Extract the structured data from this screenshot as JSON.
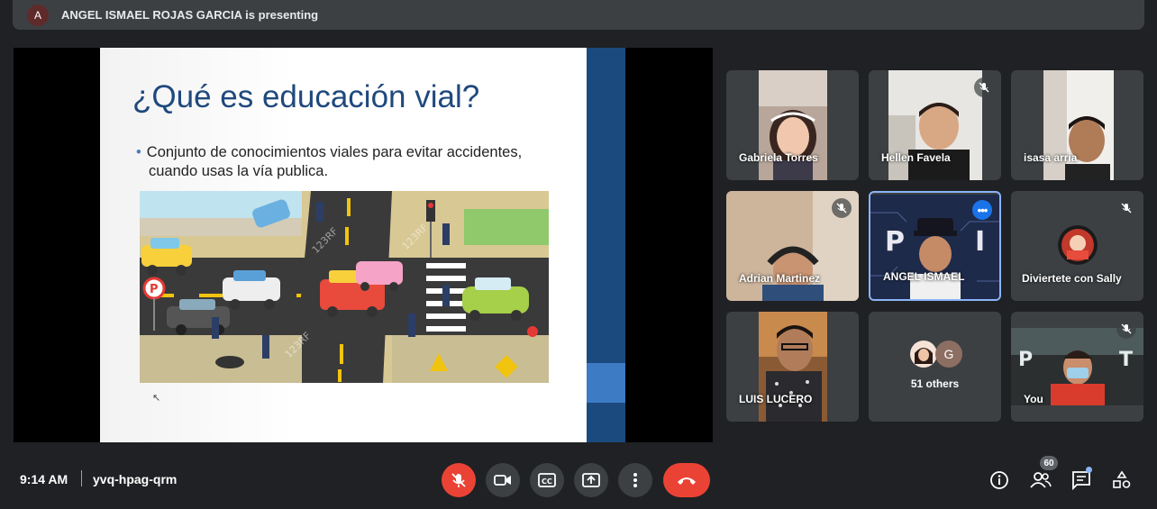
{
  "header": {
    "presenter_initial": "A",
    "presenting_text": "ANGEL ISMAEL ROJAS GARCIA is presenting"
  },
  "slide": {
    "title": "¿Qué es educación vial?",
    "bullet_line1": "Conjunto de conocimientos viales para evitar accidentes,",
    "bullet_line2": "cuando usas la vía publica.",
    "watermark": "123RF"
  },
  "participants": [
    {
      "name": "Gabriela Torres"
    },
    {
      "name": "Hellen Favela"
    },
    {
      "name": "isasa arria"
    },
    {
      "name": "Adrian Martinez"
    },
    {
      "name": "ANGEL ISMAEL"
    },
    {
      "name": "Diviertete con Sally"
    },
    {
      "name": "LUIS LUCERO"
    },
    {
      "name": "51 others",
      "avatar_letter": "G"
    },
    {
      "name": "You"
    }
  ],
  "footer": {
    "time": "9:14 AM",
    "meeting_code": "yvq-hpag-qrm",
    "people_count": "60"
  },
  "colors": {
    "bg": "#202124",
    "tile": "#3c4043",
    "danger": "#ea4335",
    "active": "#8ab4f8"
  }
}
